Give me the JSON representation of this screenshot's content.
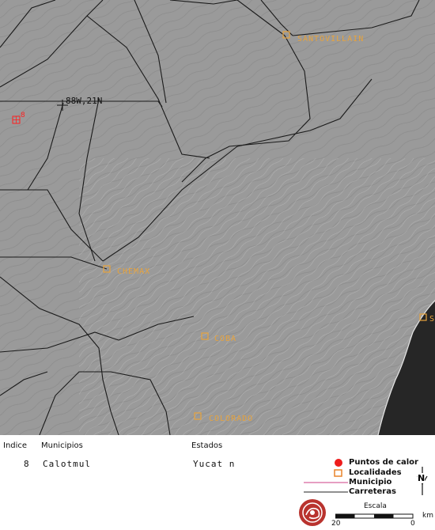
{
  "map": {
    "coordinate_label": "88W,21N",
    "hotspot_index": "8",
    "localities": [
      {
        "name": "SANTOVILLAIN"
      },
      {
        "name": "CHEMAX"
      },
      {
        "name": "COBA"
      },
      {
        "name": "COLORADO"
      },
      {
        "name": "S"
      }
    ]
  },
  "info": {
    "headers": {
      "index": "Indice",
      "municipality": "Municipios",
      "state": "Estados"
    },
    "row": {
      "index": "8",
      "municipality": "Calotmul",
      "state": "Yucat n"
    }
  },
  "legend": {
    "items": [
      {
        "label": "Puntos de calor",
        "color": "#ee1c1c"
      },
      {
        "label": "Localidades",
        "color": "#e8842a"
      },
      {
        "label": "Municipio",
        "color": "#cc3d86"
      },
      {
        "label": "Carreteras",
        "color": "#222222"
      }
    ],
    "north_label": "N",
    "scale_title": "Escala",
    "scale_ticks": [
      "20",
      "0"
    ],
    "scale_unit": "km"
  },
  "colors": {
    "land": "#9a9a9a",
    "sea": "#262626",
    "locality": "#e8a33c",
    "hotspot": "#ff2020"
  }
}
